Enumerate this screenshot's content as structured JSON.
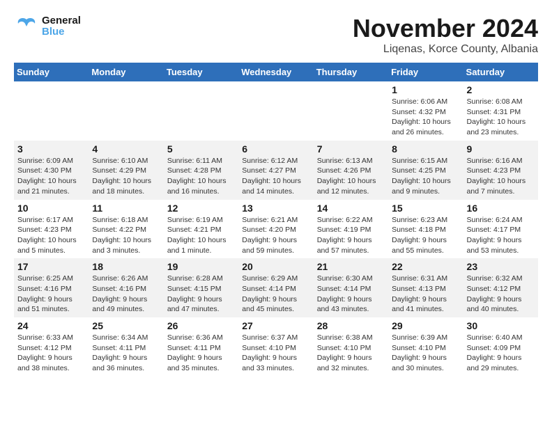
{
  "header": {
    "logo_line1": "General",
    "logo_line2": "Blue",
    "month_year": "November 2024",
    "location": "Liqenas, Korce County, Albania"
  },
  "weekdays": [
    "Sunday",
    "Monday",
    "Tuesday",
    "Wednesday",
    "Thursday",
    "Friday",
    "Saturday"
  ],
  "weeks": [
    [
      {
        "day": "",
        "info": ""
      },
      {
        "day": "",
        "info": ""
      },
      {
        "day": "",
        "info": ""
      },
      {
        "day": "",
        "info": ""
      },
      {
        "day": "",
        "info": ""
      },
      {
        "day": "1",
        "info": "Sunrise: 6:06 AM\nSunset: 4:32 PM\nDaylight: 10 hours and 26 minutes."
      },
      {
        "day": "2",
        "info": "Sunrise: 6:08 AM\nSunset: 4:31 PM\nDaylight: 10 hours and 23 minutes."
      }
    ],
    [
      {
        "day": "3",
        "info": "Sunrise: 6:09 AM\nSunset: 4:30 PM\nDaylight: 10 hours and 21 minutes."
      },
      {
        "day": "4",
        "info": "Sunrise: 6:10 AM\nSunset: 4:29 PM\nDaylight: 10 hours and 18 minutes."
      },
      {
        "day": "5",
        "info": "Sunrise: 6:11 AM\nSunset: 4:28 PM\nDaylight: 10 hours and 16 minutes."
      },
      {
        "day": "6",
        "info": "Sunrise: 6:12 AM\nSunset: 4:27 PM\nDaylight: 10 hours and 14 minutes."
      },
      {
        "day": "7",
        "info": "Sunrise: 6:13 AM\nSunset: 4:26 PM\nDaylight: 10 hours and 12 minutes."
      },
      {
        "day": "8",
        "info": "Sunrise: 6:15 AM\nSunset: 4:25 PM\nDaylight: 10 hours and 9 minutes."
      },
      {
        "day": "9",
        "info": "Sunrise: 6:16 AM\nSunset: 4:23 PM\nDaylight: 10 hours and 7 minutes."
      }
    ],
    [
      {
        "day": "10",
        "info": "Sunrise: 6:17 AM\nSunset: 4:23 PM\nDaylight: 10 hours and 5 minutes."
      },
      {
        "day": "11",
        "info": "Sunrise: 6:18 AM\nSunset: 4:22 PM\nDaylight: 10 hours and 3 minutes."
      },
      {
        "day": "12",
        "info": "Sunrise: 6:19 AM\nSunset: 4:21 PM\nDaylight: 10 hours and 1 minute."
      },
      {
        "day": "13",
        "info": "Sunrise: 6:21 AM\nSunset: 4:20 PM\nDaylight: 9 hours and 59 minutes."
      },
      {
        "day": "14",
        "info": "Sunrise: 6:22 AM\nSunset: 4:19 PM\nDaylight: 9 hours and 57 minutes."
      },
      {
        "day": "15",
        "info": "Sunrise: 6:23 AM\nSunset: 4:18 PM\nDaylight: 9 hours and 55 minutes."
      },
      {
        "day": "16",
        "info": "Sunrise: 6:24 AM\nSunset: 4:17 PM\nDaylight: 9 hours and 53 minutes."
      }
    ],
    [
      {
        "day": "17",
        "info": "Sunrise: 6:25 AM\nSunset: 4:16 PM\nDaylight: 9 hours and 51 minutes."
      },
      {
        "day": "18",
        "info": "Sunrise: 6:26 AM\nSunset: 4:16 PM\nDaylight: 9 hours and 49 minutes."
      },
      {
        "day": "19",
        "info": "Sunrise: 6:28 AM\nSunset: 4:15 PM\nDaylight: 9 hours and 47 minutes."
      },
      {
        "day": "20",
        "info": "Sunrise: 6:29 AM\nSunset: 4:14 PM\nDaylight: 9 hours and 45 minutes."
      },
      {
        "day": "21",
        "info": "Sunrise: 6:30 AM\nSunset: 4:14 PM\nDaylight: 9 hours and 43 minutes."
      },
      {
        "day": "22",
        "info": "Sunrise: 6:31 AM\nSunset: 4:13 PM\nDaylight: 9 hours and 41 minutes."
      },
      {
        "day": "23",
        "info": "Sunrise: 6:32 AM\nSunset: 4:12 PM\nDaylight: 9 hours and 40 minutes."
      }
    ],
    [
      {
        "day": "24",
        "info": "Sunrise: 6:33 AM\nSunset: 4:12 PM\nDaylight: 9 hours and 38 minutes."
      },
      {
        "day": "25",
        "info": "Sunrise: 6:34 AM\nSunset: 4:11 PM\nDaylight: 9 hours and 36 minutes."
      },
      {
        "day": "26",
        "info": "Sunrise: 6:36 AM\nSunset: 4:11 PM\nDaylight: 9 hours and 35 minutes."
      },
      {
        "day": "27",
        "info": "Sunrise: 6:37 AM\nSunset: 4:10 PM\nDaylight: 9 hours and 33 minutes."
      },
      {
        "day": "28",
        "info": "Sunrise: 6:38 AM\nSunset: 4:10 PM\nDaylight: 9 hours and 32 minutes."
      },
      {
        "day": "29",
        "info": "Sunrise: 6:39 AM\nSunset: 4:10 PM\nDaylight: 9 hours and 30 minutes."
      },
      {
        "day": "30",
        "info": "Sunrise: 6:40 AM\nSunset: 4:09 PM\nDaylight: 9 hours and 29 minutes."
      }
    ]
  ]
}
